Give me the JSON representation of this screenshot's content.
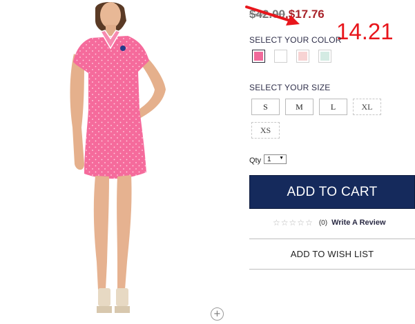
{
  "product": {
    "image_alt": "Woman in pink polka-dot polo dress"
  },
  "price": {
    "original": "$42.00",
    "separator": ",",
    "sale": "$17.76"
  },
  "annotation": {
    "text": "14.21",
    "color": "#e8161c"
  },
  "color_section": {
    "label": "SELECT YOUR COLOR",
    "swatches": [
      {
        "name": "pink",
        "hex": "#f0699a",
        "selected": true
      },
      {
        "name": "white",
        "hex": "#ffffff",
        "selected": false
      },
      {
        "name": "light-pink",
        "hex": "#f7d3d3",
        "selected": false
      },
      {
        "name": "mint",
        "hex": "#d4ebe3",
        "selected": false
      }
    ]
  },
  "size_section": {
    "label": "SELECT YOUR SIZE",
    "sizes": [
      {
        "label": "S",
        "available": true
      },
      {
        "label": "M",
        "available": true
      },
      {
        "label": "L",
        "available": true
      },
      {
        "label": "XL",
        "available": false
      },
      {
        "label": "XS",
        "available": false
      }
    ]
  },
  "qty": {
    "label": "Qty",
    "value": "1"
  },
  "cart": {
    "add_label": "ADD TO CART",
    "color": "#152a5c"
  },
  "reviews": {
    "rating": 0,
    "count": "(0)",
    "write_label": "Write A Review"
  },
  "wish_list": {
    "label": "ADD TO WISH LIST"
  },
  "icons": {
    "zoom": "plus-circle-icon",
    "star": "star-outline-icon",
    "dropdown": "chevron-down-icon",
    "arrow": "red-arrow-annotation"
  }
}
